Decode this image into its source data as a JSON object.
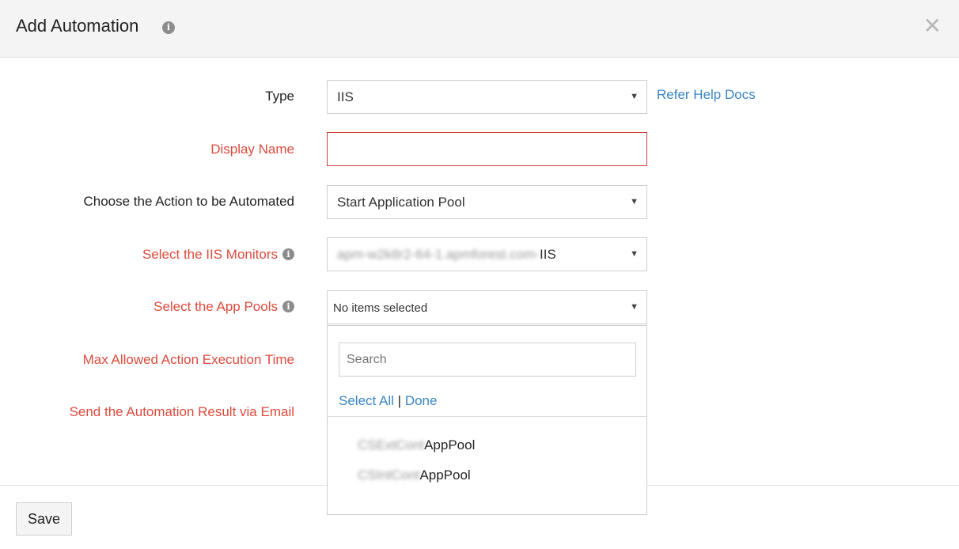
{
  "dialog": {
    "title": "Add Automation",
    "info_icon": "info-icon",
    "close_icon": "close-icon",
    "close_glyph": "✕"
  },
  "form": {
    "type": {
      "label": "Type",
      "value": "IIS",
      "help_link": "Refer Help Docs"
    },
    "display_name": {
      "label": "Display Name",
      "value": ""
    },
    "action": {
      "label": "Choose the Action to be Automated",
      "value": "Start Application Pool"
    },
    "iis_monitors": {
      "label": "Select the IIS Monitors",
      "value_blurred": "apm-w2k8r2-64-1.apmforest.com-",
      "value_suffix": "IIS"
    },
    "app_pools": {
      "label": "Select the App Pools",
      "value": "No items selected"
    },
    "max_time": {
      "label": "Max Allowed Action Execution Time"
    },
    "send_email": {
      "label": "Send the Automation Result via Email"
    }
  },
  "app_pool_dropdown": {
    "search_placeholder": "Search",
    "select_all": "Select All",
    "separator": "|",
    "done": "Done",
    "items": [
      {
        "blurred": "CSExtCont",
        "suffix": "AppPool"
      },
      {
        "blurred": "CSIntCont",
        "suffix": "AppPool"
      }
    ]
  },
  "footer": {
    "save_label": "Save"
  },
  "colors": {
    "required_label": "#de4a3d",
    "link": "#3a85c6",
    "error_border": "#d04040"
  }
}
